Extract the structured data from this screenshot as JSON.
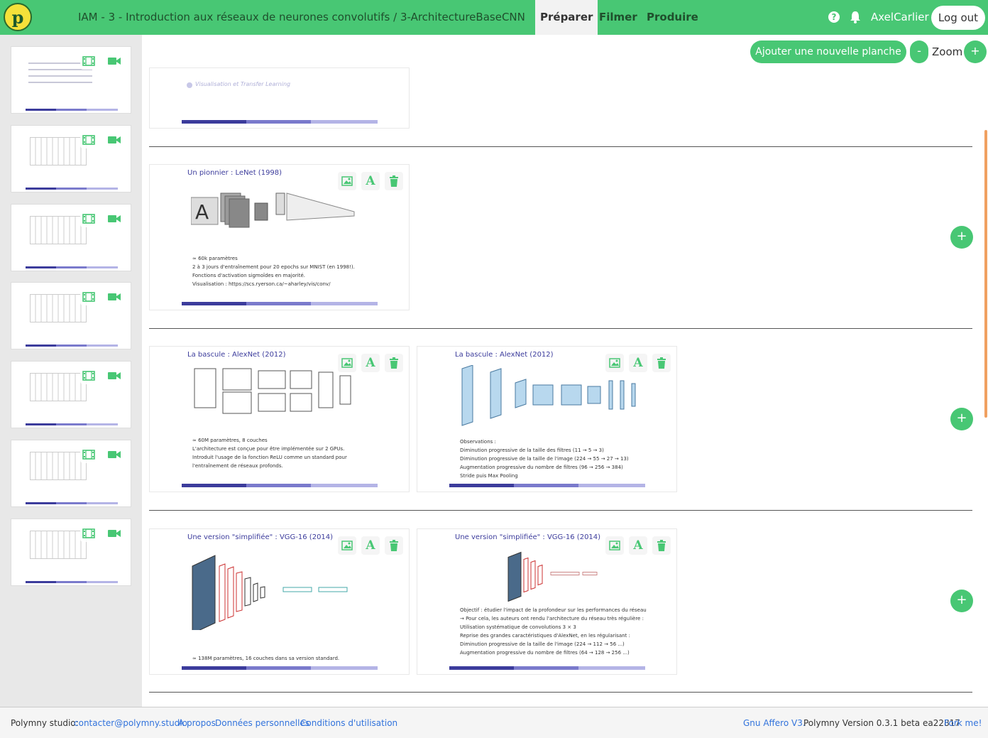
{
  "header": {
    "logo": "p",
    "breadcrumb": "IAM - 3 - Introduction aux réseaux de neurones convolutifs / 3-ArchitectureBaseCNN",
    "tabs": [
      {
        "label": "Préparer",
        "active": true
      },
      {
        "label": "Filmer",
        "active": false
      },
      {
        "label": "Produire",
        "active": false
      }
    ],
    "help_icon": "?",
    "username": "AxelCarlier",
    "logout_label": "Log out"
  },
  "toolbar": {
    "add_slide_label": "Ajouter une nouvelle planche",
    "zoom_minus": "-",
    "zoom_label": "Zoom",
    "zoom_plus": "+"
  },
  "slides": [
    {
      "title": "Un pionnier : LeNet (1998)",
      "bullets": [
        "≃ 60k paramètres",
        "2 à 3 jours d'entraînement pour 20 epochs sur MNIST (en 1998!).",
        "Fonctions d'activation sigmoïdes en majorité.",
        "Visualisation : https://scs.ryerson.ca/~aharley/vis/conv/"
      ]
    },
    {
      "title": "La bascule : AlexNet (2012)",
      "bullets": [
        "≃ 60M paramètres, 8 couches",
        "L'architecture est conçue pour être implémentée sur 2 GPUs.",
        "Introduit l'usage de la fonction ReLU comme un standard pour",
        "l'entraînement de réseaux profonds."
      ]
    },
    {
      "title": "La bascule : AlexNet (2012)",
      "bullets": [
        "Observations :",
        "Diminution progressive de la taille des filtres (11 → 5 → 3)",
        "Diminution progressive de la taille de l'image (224 → 55 → 27 → 13)",
        "Augmentation progressive du nombre de filtres (96 → 256 → 384)",
        "Stride puis Max Pooling"
      ]
    },
    {
      "title": "Une version \"simplifiée\" : VGG-16 (2014)",
      "bullets": [
        "≃ 138M paramètres, 16 couches dans sa version standard."
      ]
    },
    {
      "title": "Une version \"simplifiée\" : VGG-16 (2014)",
      "bullets": [
        "Objectif : étudier l'impact de la profondeur sur les performances du réseau",
        "→ Pour cela, les auteurs ont rendu l'architecture du réseau très régulière :",
        "Utilisation systématique de convolutions 3 × 3",
        "Reprise des grandes caractéristiques d'AlexNet, en les régularisant :",
        "Diminution progressive de la taille de l'image (224 → 112 → 56 ...)",
        "Augmentation progressive du nombre de filtres (64 → 128 → 256 ...)"
      ]
    }
  ],
  "first_slide_partial": "Visualisation et Transfer Learning",
  "add_row_label": "+",
  "footer": {
    "label": "Polymny studio:",
    "links": [
      "contacter@polymny.studio",
      "A propos",
      "Données personnelles",
      "Conditions d'utilisation"
    ],
    "license": "Gnu Affero V3.",
    "version": "Polymny Version 0.3.1 beta ea22817",
    "fork": "Fork me!"
  },
  "colors": {
    "accent": "#48c774",
    "slide_title": "#3c3c9c",
    "link": "#3273dc"
  }
}
